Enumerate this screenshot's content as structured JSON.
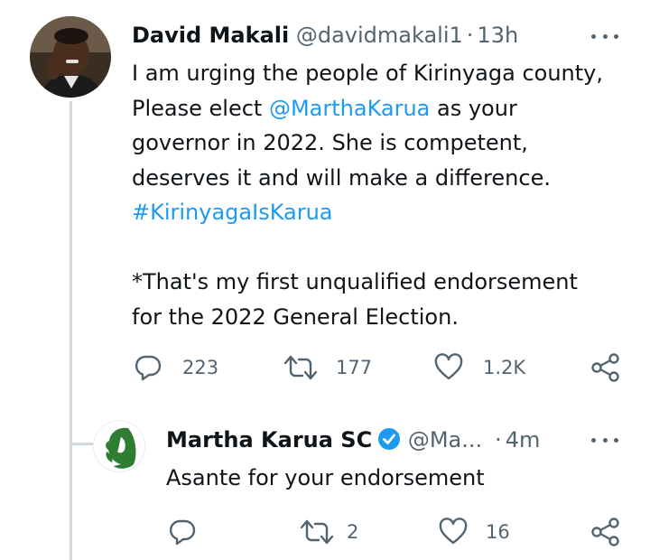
{
  "tweet": {
    "author_name": "David Makali",
    "author_handle": "@davidmakali1",
    "time": "13h",
    "text_parts": {
      "line1": "I am urging the people of Kirinyaga county,",
      "line2_pre": "Please elect ",
      "mention": "@MarthaKarua",
      "line2_post": " as your",
      "line3": "governor in 2022. She is competent,",
      "line4": "deserves it and will make a difference.",
      "hashtag": "#KirinyagaIsKarua",
      "line6": "*That's my first unqualified endorsement",
      "line7": "for the 2022 General Election."
    },
    "stats": {
      "replies": "223",
      "retweets": "177",
      "likes": "1.2K"
    }
  },
  "reply": {
    "author_name": "Martha Karua SC",
    "author_handle": "@Ma...",
    "time": "4m",
    "text": "Asante for your endorsement",
    "stats": {
      "replies": "",
      "retweets": "2",
      "likes": "16"
    }
  },
  "colors": {
    "link": "#1d9bf0",
    "muted": "#536471",
    "line": "#cfd9de",
    "brand_green": "#2e7d32"
  },
  "icons": [
    "reply-icon",
    "retweet-icon",
    "like-icon",
    "share-icon",
    "more-icon",
    "verified-badge-icon"
  ]
}
